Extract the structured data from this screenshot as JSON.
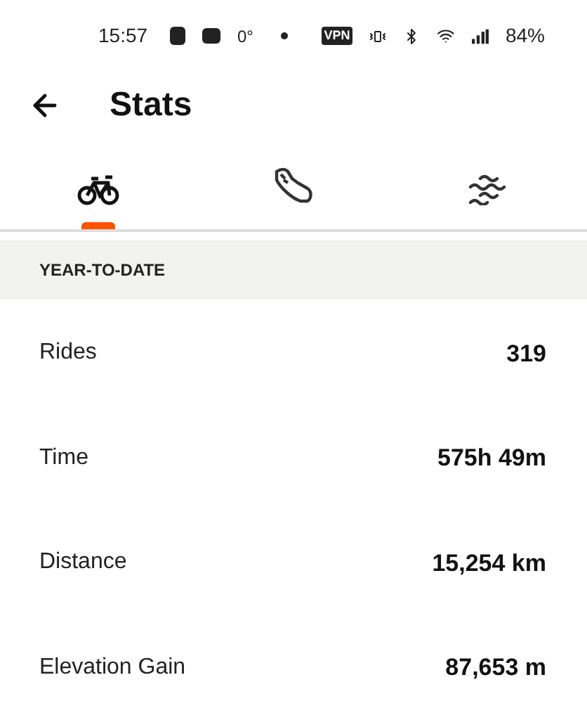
{
  "status_bar": {
    "time": "15:57",
    "temperature": "0°",
    "vpn": "VPN",
    "battery": "84%"
  },
  "header": {
    "title": "Stats"
  },
  "tabs": [
    {
      "kind": "ride",
      "selected": true
    },
    {
      "kind": "run",
      "selected": false
    },
    {
      "kind": "swim",
      "selected": false
    }
  ],
  "section": {
    "title": "YEAR-TO-DATE"
  },
  "stats": [
    {
      "label": "Rides",
      "value": "319"
    },
    {
      "label": "Time",
      "value": "575h 49m"
    },
    {
      "label": "Distance",
      "value": "15,254 km"
    },
    {
      "label": "Elevation Gain",
      "value": "87,653 m"
    }
  ]
}
